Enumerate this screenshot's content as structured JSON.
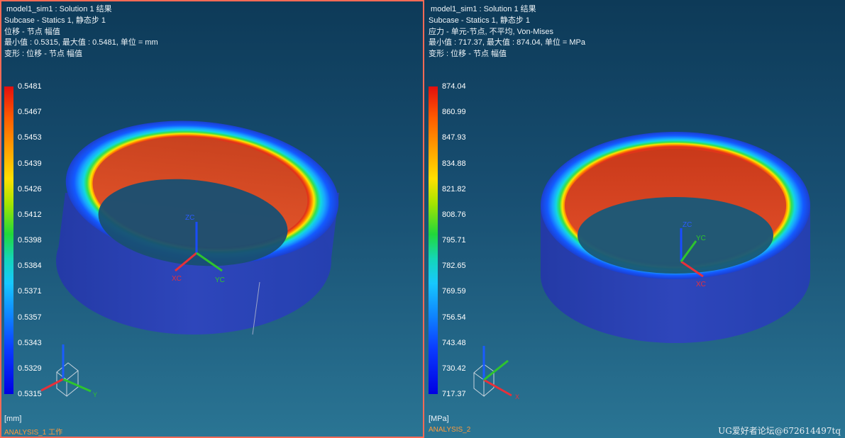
{
  "left_view": {
    "info": [
      " model1_sim1 : Solution 1 结果",
      "Subcase - Statics 1, 静态步 1",
      "位移 - 节点 幅值",
      "最小值 : 0.5315, 最大值 : 0.5481, 单位 = mm",
      "变形 : 位移 - 节点 幅值"
    ],
    "ticks": [
      "0.5481",
      "0.5467",
      "0.5453",
      "0.5439",
      "0.5426",
      "0.5412",
      "0.5398",
      "0.5384",
      "0.5371",
      "0.5357",
      "0.5343",
      "0.5329",
      "0.5315"
    ],
    "unit": "[mm]",
    "tagline": "ANALYSIS_1 工作",
    "axis_labels": {
      "zc": "ZC",
      "xc": "XC",
      "yc": "YC",
      "triad_y": "Y"
    }
  },
  "right_view": {
    "info": [
      " model1_sim1 : Solution 1 结果",
      "Subcase - Statics 1, 静态步 1",
      "应力 - 单元-节点, 不平均, Von-Mises",
      "最小值 : 717.37, 最大值 : 874.04, 单位 = MPa",
      "变形 : 位移 - 节点 幅值"
    ],
    "ticks": [
      "874.04",
      "860.99",
      "847.93",
      "834.88",
      "821.82",
      "808.76",
      "795.71",
      "782.65",
      "769.59",
      "756.54",
      "743.48",
      "730.42",
      "717.37"
    ],
    "unit": "[MPa]",
    "tagline": "ANALYSIS_2",
    "axis_labels": {
      "zc": "ZC",
      "xc": "XC",
      "yc": "YC",
      "triad_x": "X"
    }
  },
  "watermark": "UG爱好者论坛@672614497tq",
  "colors": {
    "frame_active": "#ff6a55",
    "bg_top": "#0d3a58",
    "bg_bottom": "#2a7594",
    "tagline": "#ff9a3c"
  }
}
